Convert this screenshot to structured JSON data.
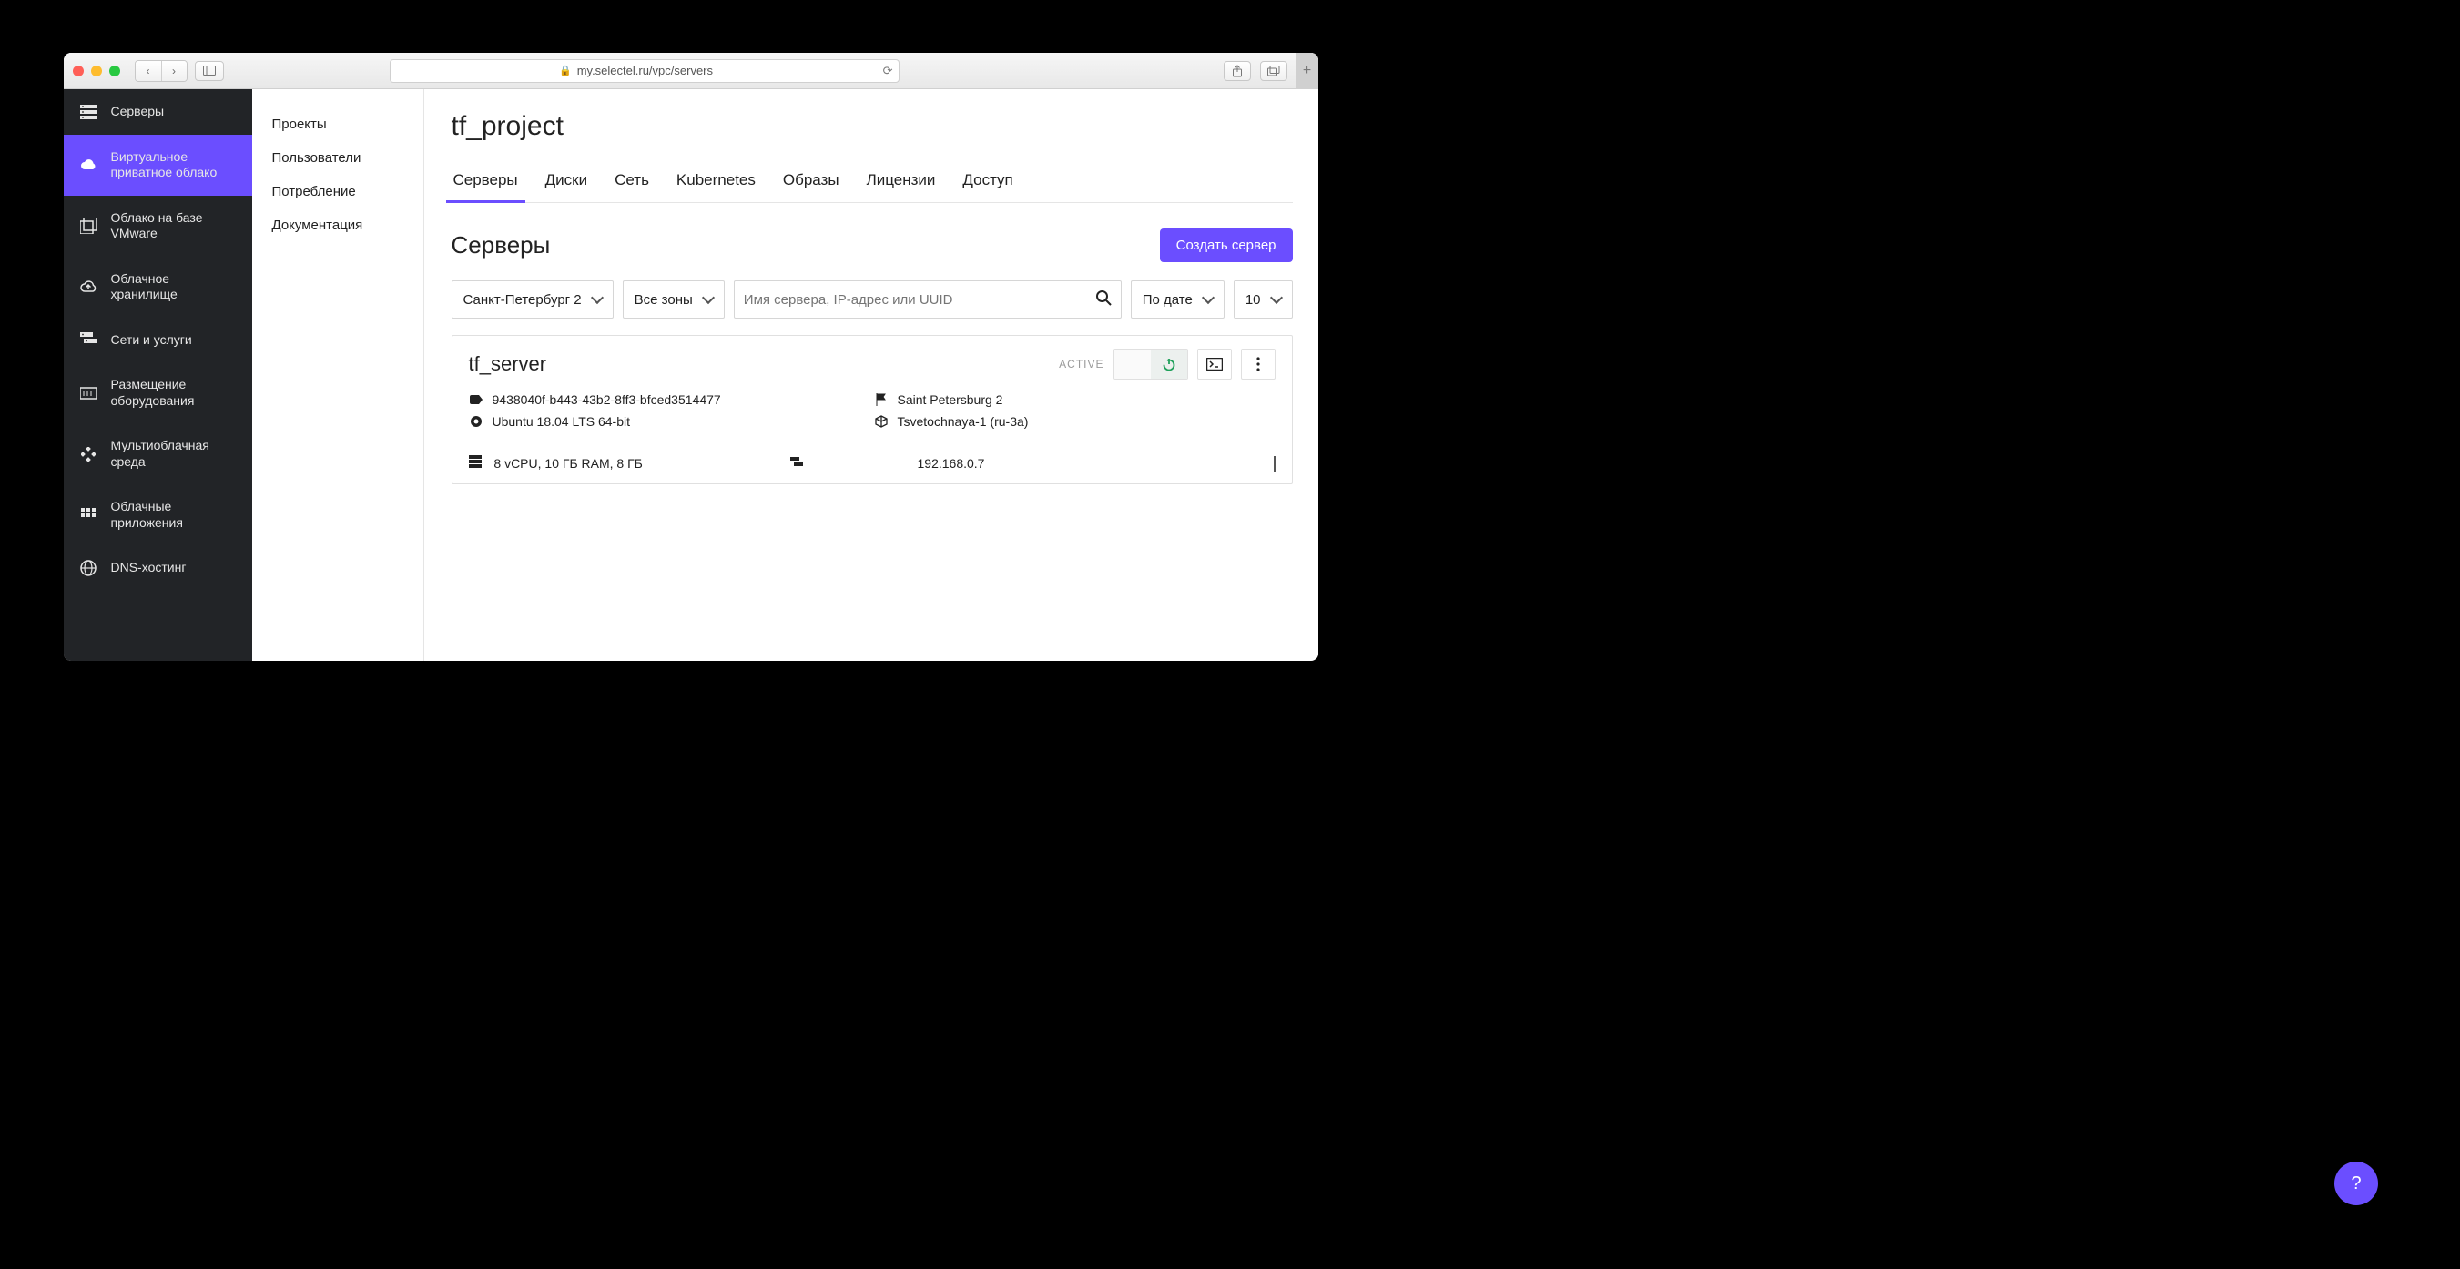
{
  "browser": {
    "url": "my.selectel.ru/vpc/servers"
  },
  "sidebar": {
    "items": [
      {
        "label": "Серверы"
      },
      {
        "label": "Виртуальное приватное облако"
      },
      {
        "label": "Облако на базе VMware"
      },
      {
        "label": "Облачное хранилище"
      },
      {
        "label": "Сети и услуги"
      },
      {
        "label": "Размещение оборудования"
      },
      {
        "label": "Мультиоблачная среда"
      },
      {
        "label": "Облачные приложения"
      },
      {
        "label": "DNS-хостинг"
      }
    ]
  },
  "secondary": {
    "items": [
      "Проекты",
      "Пользователи",
      "Потребление",
      "Документация"
    ]
  },
  "page": {
    "title": "tf_project",
    "tabs": [
      "Серверы",
      "Диски",
      "Сеть",
      "Kubernetes",
      "Образы",
      "Лицензии",
      "Доступ"
    ],
    "section_title": "Серверы",
    "create_button": "Создать сервер"
  },
  "filters": {
    "region": "Санкт-Петербург 2",
    "zone": "Все зоны",
    "search_placeholder": "Имя сервера, IP-адрес или UUID",
    "sort": "По дате",
    "page_size": "10"
  },
  "server": {
    "name": "tf_server",
    "status": "ACTIVE",
    "uuid": "9438040f-b443-43b2-8ff3-bfced3514477",
    "location": "Saint Petersburg 2",
    "os": "Ubuntu 18.04 LTS 64-bit",
    "zone": "Tsvetochnaya-1 (ru-3a)",
    "specs": "8 vCPU, 10 ГБ RAM, 8 ГБ",
    "ip": "192.168.0.7"
  },
  "help": {
    "label": "?"
  },
  "colors": {
    "accent": "#6b4eff",
    "sidebar_bg": "#222427",
    "success": "#1fa05a"
  }
}
